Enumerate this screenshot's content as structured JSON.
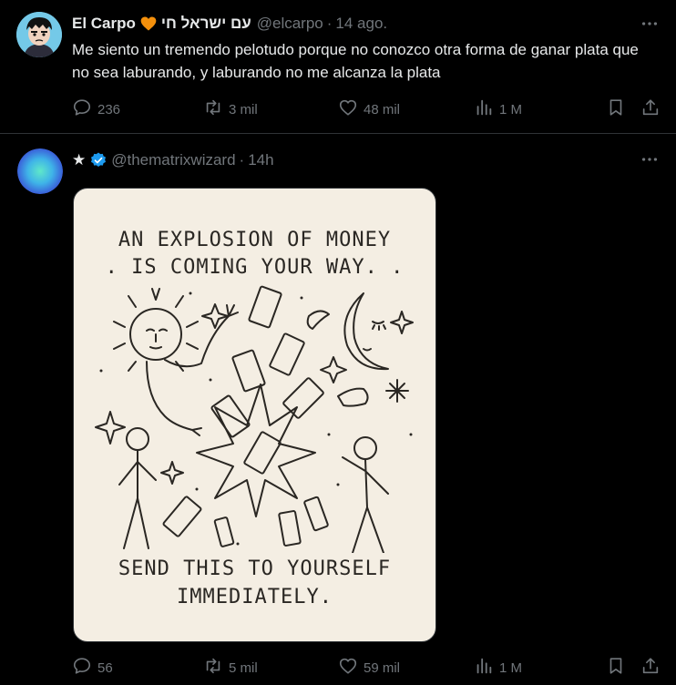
{
  "tweets": [
    {
      "display_name": "El Carpo",
      "name_suffix": "עם ישראל חי",
      "handle": "@elcarpo",
      "separator": "·",
      "time": "14 ago.",
      "text": "Me siento un tremendo pelotudo porque no conozco otra forma de ganar plata que no sea laburando, y laburando no me alcanza la plata",
      "metrics": {
        "replies": "236",
        "reposts": "3 mil",
        "likes": "48 mil",
        "views": "1 M"
      }
    },
    {
      "name_prefix": "★",
      "handle": "@thematrixwizard",
      "separator": "·",
      "time": "14h",
      "verified": true,
      "image": {
        "line1": "AN EXPLOSION OF MONEY",
        "line2": ". IS COMING YOUR WAY. .",
        "line3": "SEND THIS TO YOURSELF",
        "line4": "IMMEDIATELY."
      },
      "metrics": {
        "replies": "56",
        "reposts": "5 mil",
        "likes": "59 mil",
        "views": "1 M"
      }
    }
  ],
  "colors": {
    "background": "#000000",
    "muted": "#71767b",
    "verified": "#1d9bf0",
    "heart_emoji": "#f4900c",
    "card": "#f4eee3"
  },
  "icons": [
    "reply-icon",
    "repost-icon",
    "like-icon",
    "views-icon",
    "bookmark-icon",
    "share-icon",
    "more-icon",
    "verified-badge-icon",
    "orange-heart-icon"
  ]
}
